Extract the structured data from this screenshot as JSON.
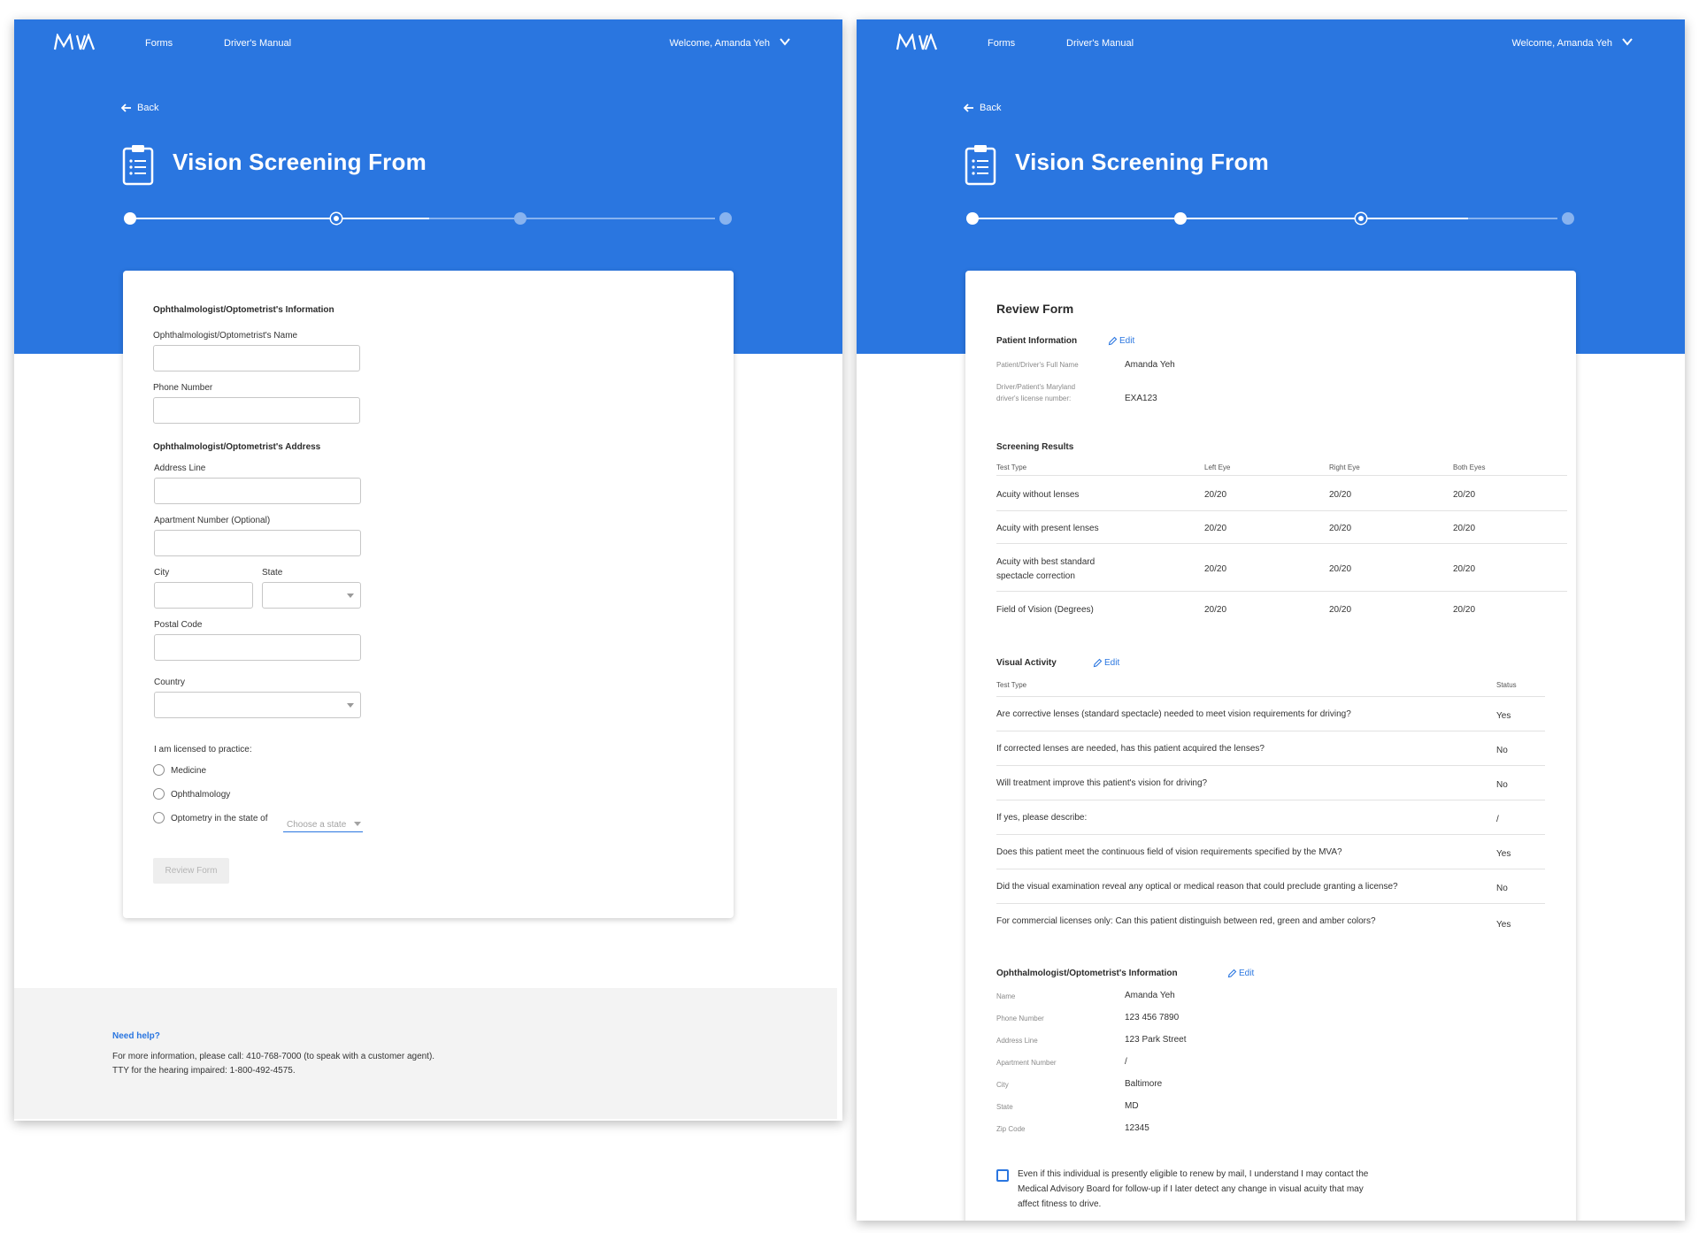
{
  "colors": {
    "brand_blue": "#2a76e0",
    "stepper_future": "#88b3ef",
    "footer_bg": "#f3f3f3",
    "disabled_button_bg": "#eeeeee"
  },
  "nav": {
    "logo": "MVA",
    "forms": "Forms",
    "drivers_manual": "Driver's Manual",
    "welcome": "Welcome, Amanda Yeh",
    "back": "Back"
  },
  "page_title": "Vision Screening From",
  "steps_total": 4,
  "left": {
    "current_step": 2,
    "section_info_title": "Ophthalmologist/Optometrist's Information",
    "name_label": "Ophthalmologist/Optometrist's Name",
    "phone_label": "Phone Number",
    "section_address_title": "Ophthalmologist/Optometrist's Address",
    "address_line_label": "Address Line",
    "apartment_label": "Apartment Number (Optional)",
    "city_label": "City",
    "state_label": "State",
    "postal_label": "Postal Code",
    "country_label": "Country",
    "licensed_label": "I am licensed to practice:",
    "radio_medicine": "Medicine",
    "radio_ophthalmology": "Ophthalmology",
    "radio_optometry": "Optometry in the state of",
    "choose_state": "Choose a state",
    "review_button": "Review Form",
    "footer": {
      "help_title": "Need help?",
      "line1": "For more information, please call: 410-768-7000 (to speak with a customer agent).",
      "line2": "TTY for the hearing impaired: 1-800-492-4575."
    }
  },
  "right": {
    "current_step": 3,
    "review_title": "Review Form",
    "edit": "Edit",
    "patient": {
      "title": "Patient Information",
      "full_name_label": "Patient/Driver's Full Name",
      "full_name": "Amanda Yeh",
      "license_label_1": "Driver/Patient's Maryland",
      "license_label_2": "driver's license number:",
      "license": "EXA123"
    },
    "screening": {
      "title": "Screening Results",
      "headers": [
        "Test Type",
        "Left Eye",
        "Right Eye",
        "Both Eyes"
      ],
      "rows": [
        {
          "test": "Acuity without lenses",
          "left": "20/20",
          "right": "20/20",
          "both": "20/20"
        },
        {
          "test": "Acuity with present lenses",
          "left": "20/20",
          "right": "20/20",
          "both": "20/20"
        },
        {
          "test": "Acuity with best standard spectacle correction",
          "left": "20/20",
          "right": "20/20",
          "both": "20/20"
        },
        {
          "test": "Field of Vision (Degrees)",
          "left": "20/20",
          "right": "20/20",
          "both": "20/20"
        }
      ]
    },
    "visual": {
      "title": "Visual Activity",
      "headers": [
        "Test Type",
        "Status"
      ],
      "rows": [
        {
          "q": "Are corrective lenses (standard spectacle) needed to meet vision requirements for driving?",
          "s": "Yes"
        },
        {
          "q": "If corrected lenses are needed, has this patient acquired the lenses?",
          "s": "No"
        },
        {
          "q": "Will treatment improve this patient's vision for driving?",
          "s": "No"
        },
        {
          "q": "If yes, please describe:",
          "s": "/"
        },
        {
          "q": "Does this patient meet the continuous field of vision requirements specified by the MVA?",
          "s": "Yes"
        },
        {
          "q": "Did the visual examination reveal any optical or medical reason that could preclude granting a license?",
          "s": "No"
        },
        {
          "q": "For commercial licenses only: Can this patient distinguish between red, green and amber colors?",
          "s": "Yes"
        }
      ]
    },
    "doctor": {
      "title": "Ophthalmologist/Optometrist's Information",
      "rows": [
        {
          "label": "Name",
          "value": "Amanda Yeh"
        },
        {
          "label": "Phone Number",
          "value": "123 456 7890"
        },
        {
          "label": "Address Line",
          "value": "123 Park Street"
        },
        {
          "label": "Apartment Number",
          "value": "/"
        },
        {
          "label": "City",
          "value": "Baltimore"
        },
        {
          "label": "State",
          "value": "MD"
        },
        {
          "label": "Zip Code",
          "value": "12345"
        }
      ]
    },
    "consent": "Even if this individual is presently eligible to renew by mail, I understand I may contact the Medical Advisory Board for follow-up if I later detect any change in visual acuity that may affect fitness to drive."
  }
}
